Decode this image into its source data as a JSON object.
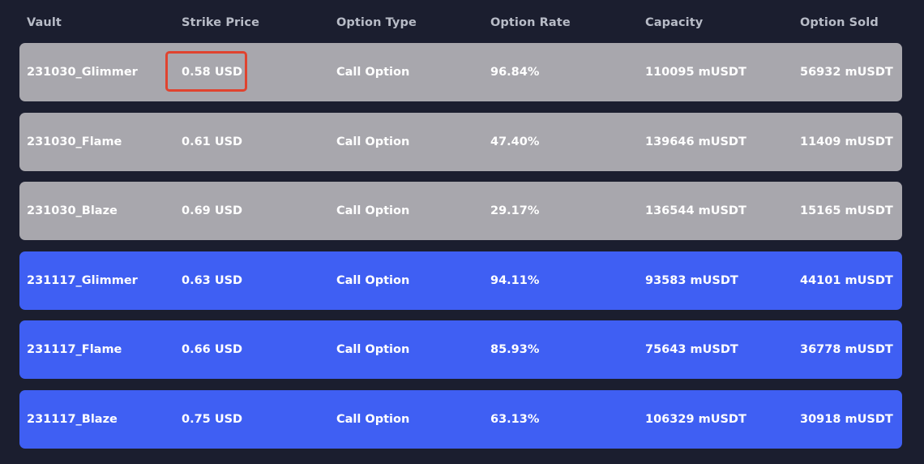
{
  "table": {
    "headers": [
      "Vault",
      "Strike Price",
      "Option Type",
      "Option Rate",
      "Capacity",
      "Option Sold"
    ],
    "rows": [
      {
        "vault": "231030_Glimmer",
        "strike_price": "0.58 USD",
        "option_type": "Call Option",
        "option_rate": "96.84%",
        "capacity": "110095 mUSDT",
        "option_sold": "56932 mUSDT",
        "color": "#a8a7ad"
      },
      {
        "vault": "231030_Flame",
        "strike_price": "0.61 USD",
        "option_type": "Call Option",
        "option_rate": "47.40%",
        "capacity": "139646 mUSDT",
        "option_sold": "11409 mUSDT",
        "color": "#a8a7ad"
      },
      {
        "vault": "231030_Blaze",
        "strike_price": "0.69 USD",
        "option_type": "Call Option",
        "option_rate": "29.17%",
        "capacity": "136544 mUSDT",
        "option_sold": "15165 mUSDT",
        "color": "#a8a7ad"
      },
      {
        "vault": "231117_Glimmer",
        "strike_price": "0.63 USD",
        "option_type": "Call Option",
        "option_rate": "94.11%",
        "capacity": "93583 mUSDT",
        "option_sold": "44101 mUSDT",
        "color": "#3f5ff3"
      },
      {
        "vault": "231117_Flame",
        "strike_price": "0.66 USD",
        "option_type": "Call Option",
        "option_rate": "85.93%",
        "capacity": "75643 mUSDT",
        "option_sold": "36778 mUSDT",
        "color": "#3f5ff3"
      },
      {
        "vault": "231117_Blaze",
        "strike_price": "0.75 USD",
        "option_type": "Call Option",
        "option_rate": "63.13%",
        "capacity": "106329 mUSDT",
        "option_sold": "30918 mUSDT",
        "color": "#3f5ff3"
      }
    ]
  },
  "highlight": {
    "color": "#e0432f"
  }
}
